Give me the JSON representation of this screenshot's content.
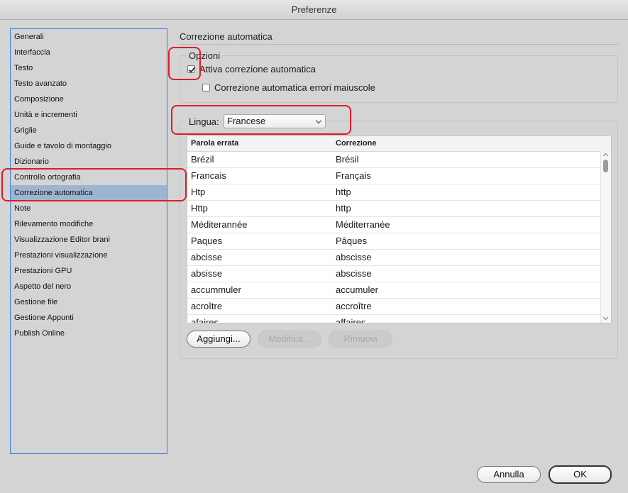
{
  "window": {
    "title": "Preferenze"
  },
  "sidebar": {
    "items": [
      {
        "label": "Generali"
      },
      {
        "label": "Interfaccia"
      },
      {
        "label": "Testo"
      },
      {
        "label": "Testo avanzato"
      },
      {
        "label": "Composizione"
      },
      {
        "label": "Unità e incrementi"
      },
      {
        "label": "Griglie"
      },
      {
        "label": "Guide e tavolo di montaggio"
      },
      {
        "label": "Dizionario"
      },
      {
        "label": "Controllo ortografia"
      },
      {
        "label": "Correzione automatica",
        "selected": true
      },
      {
        "label": "Note"
      },
      {
        "label": "Rilevamento modifiche"
      },
      {
        "label": "Visualizzazione Editor brani"
      },
      {
        "label": "Prestazioni visualizzazione"
      },
      {
        "label": "Prestazioni GPU"
      },
      {
        "label": "Aspetto del nero"
      },
      {
        "label": "Gestione file"
      },
      {
        "label": "Gestione Appunti"
      },
      {
        "label": "Publish Online"
      }
    ]
  },
  "main": {
    "section_title": "Correzione automatica",
    "options": {
      "legend": "Opzioni",
      "enable_autocorrect": {
        "label": "Attiva correzione automatica",
        "checked": true
      },
      "autocorrect_caps": {
        "label": "Correzione automatica errori maiuscole",
        "checked": false
      }
    },
    "language": {
      "label": "Lingua:",
      "value": "Francese"
    },
    "table": {
      "headers": [
        "Parola errata",
        "Correzione"
      ],
      "rows": [
        [
          "Brézil",
          "Brésil"
        ],
        [
          "Francais",
          "Français"
        ],
        [
          "Htp",
          "http"
        ],
        [
          "Http",
          "http"
        ],
        [
          "Méditerannée",
          "Méditerranée"
        ],
        [
          "Paques",
          "Pâques"
        ],
        [
          "abcisse",
          "abscisse"
        ],
        [
          "absisse",
          "abscisse"
        ],
        [
          "accummuler",
          "accumuler"
        ],
        [
          "acroître",
          "accroître"
        ],
        [
          "afaires",
          "affaires"
        ]
      ]
    },
    "buttons": {
      "add": "Aggiungi...",
      "edit": "Modifica...",
      "remove": "Rimuovi"
    }
  },
  "footer": {
    "cancel": "Annulla",
    "ok": "OK"
  },
  "colors": {
    "highlight": "#e01c24",
    "selection": "#9db5d1",
    "sidebar_border": "#3f7fe6"
  }
}
